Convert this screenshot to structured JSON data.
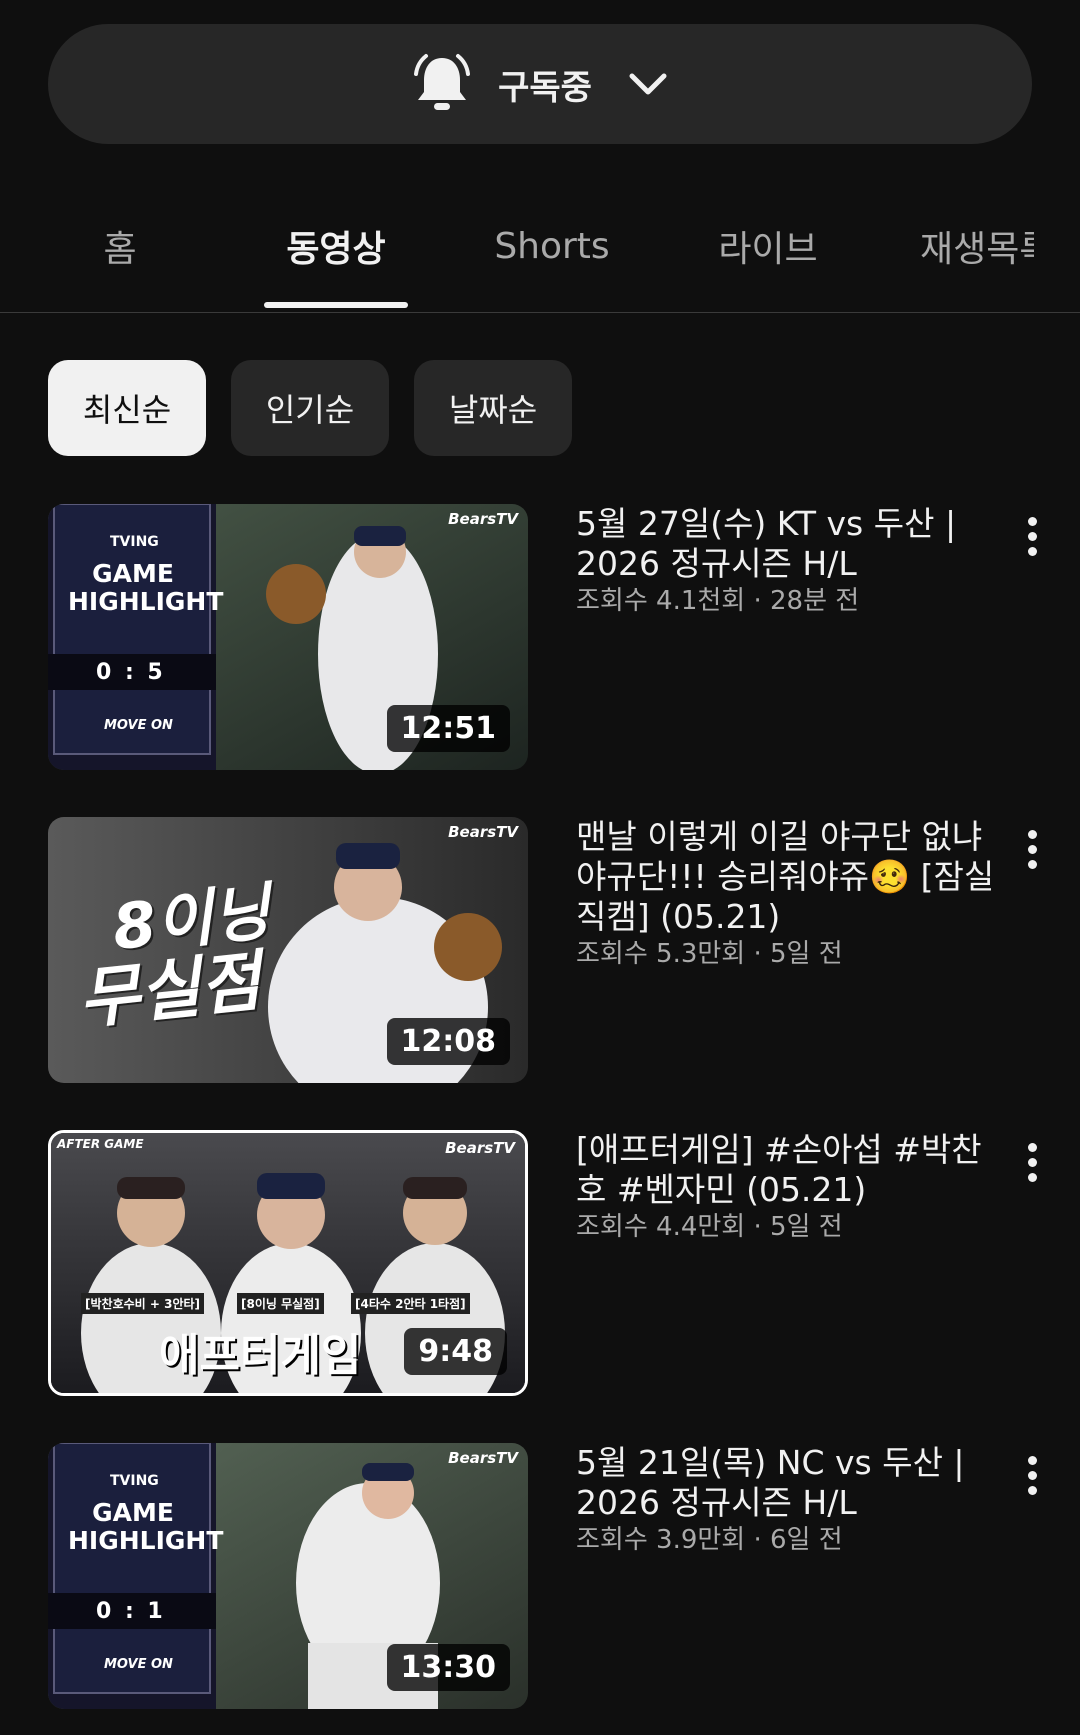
{
  "subscribe": {
    "label": "구독중",
    "icon": "bell-icon"
  },
  "tabs": [
    "홈",
    "동영상",
    "Shorts",
    "라이브",
    "재생목록"
  ],
  "active_tab": "동영상",
  "chips": [
    "최신순",
    "인기순",
    "날짜순"
  ],
  "active_chip": "최신순",
  "videos": [
    {
      "title": "5월 27일(수) KT vs 두산 | 2026 정규시즌 H/L",
      "meta": "조회수 4.1천회 · 28분 전",
      "duration": "12:51",
      "thumb": {
        "brand": "BearsTV",
        "panel_top": "TVING",
        "panel_title": "GAME HIGHLIGHT",
        "score": "0 : 5",
        "slogan": "MOVE ON"
      }
    },
    {
      "title": "맨날 이렇게 이길 야구단 없냐 야규단!!! 승리줘야쥬🥴 [잠실직캠] (05.21)",
      "meta": "조회수 5.3만회 · 5일 전",
      "duration": "12:08",
      "thumb": {
        "brand": "BearsTV",
        "big_text_1": "8이닝",
        "big_text_2": "무실점"
      }
    },
    {
      "title": "[애프터게임] #손아섭 #박찬호 #벤자민 (05.21)",
      "meta": "조회수 4.4만회 · 5일 전",
      "duration": "9:48",
      "thumb": {
        "brand": "BearsTV",
        "corner": "AFTER GAME",
        "caption_1": "[박찬호수비 + 3안타]",
        "caption_2": "[8이닝 무실점]",
        "caption_3": "[4타수 2안타 1타점]",
        "big_text": "애프터게임"
      }
    },
    {
      "title": "5월 21일(목) NC vs 두산 | 2026 정규시즌 H/L",
      "meta": "조회수 3.9만회 · 6일 전",
      "duration": "13:30",
      "thumb": {
        "brand": "BearsTV",
        "panel_top": "TVING",
        "panel_title": "GAME HIGHLIGHT",
        "score": "0 : 1",
        "slogan": "MOVE ON"
      }
    }
  ]
}
